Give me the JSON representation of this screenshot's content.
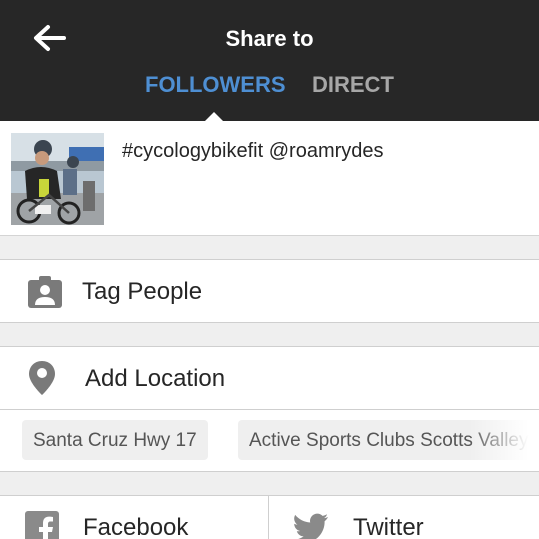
{
  "header": {
    "title": "Share to",
    "tabs": [
      {
        "label": "FOLLOWERS",
        "active": true
      },
      {
        "label": "DIRECT",
        "active": false
      }
    ]
  },
  "caption": {
    "text": "#cycologybikefit @roamrydes"
  },
  "tag_people": {
    "label": "Tag People"
  },
  "add_location": {
    "label": "Add Location"
  },
  "location_suggestions": [
    "Santa Cruz Hwy 17",
    "Active Sports Clubs Scotts Valley"
  ],
  "share": {
    "facebook": "Facebook",
    "twitter": "Twitter"
  },
  "colors": {
    "header_bg": "#272727",
    "tab_active": "#4e8fd3",
    "tab_inactive": "#a7a7a7"
  }
}
